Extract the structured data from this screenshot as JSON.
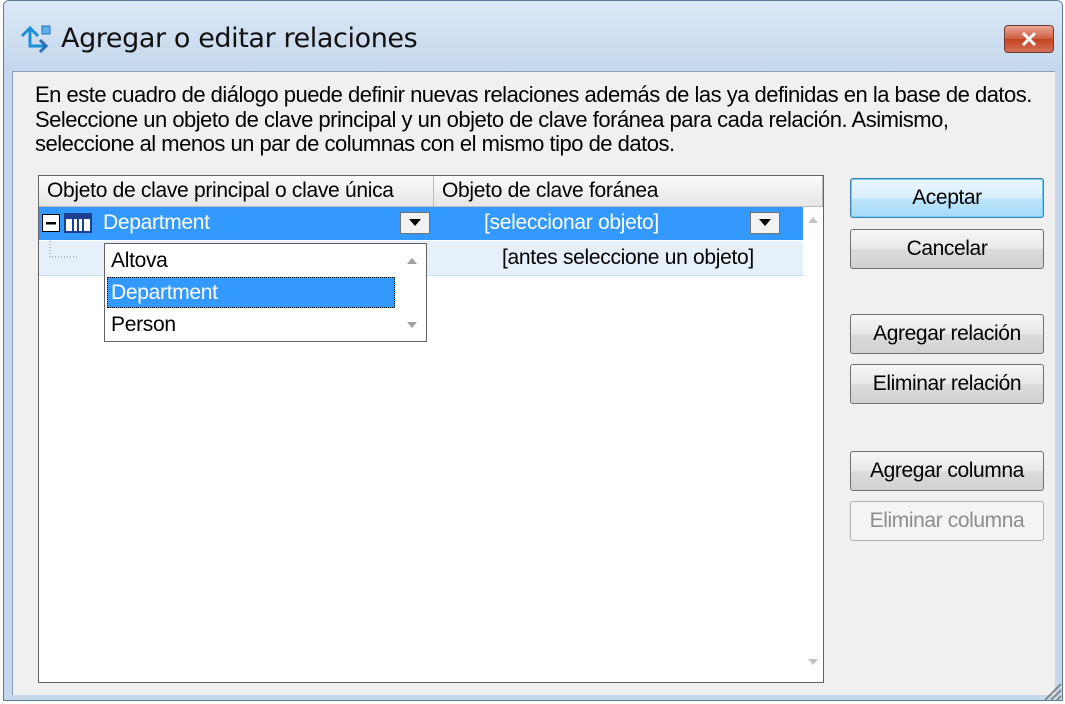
{
  "window": {
    "title": "Agregar o editar relaciones",
    "close_icon": "close-icon",
    "accent": "#3399ff",
    "close_color": "#c4421f"
  },
  "description": "En este cuadro de diálogo puede definir nuevas relaciones además de las ya definidas en la base de datos. Seleccione un objeto de clave principal y un objeto de clave foránea para cada relación. Asimismo, seleccione al menos un par de columnas con el mismo tipo de datos.",
  "grid": {
    "columns": [
      "Objeto de clave principal o clave única",
      "Objeto de clave foránea"
    ],
    "relation": {
      "primary_object": "Department",
      "foreign_object": "[seleccionar objeto]"
    },
    "column_row": {
      "foreign_column": "[antes seleccione un objeto]"
    }
  },
  "dropdown": {
    "options": [
      "Altova",
      "Department",
      "Person"
    ],
    "selected": "Department"
  },
  "buttons": {
    "ok": "Aceptar",
    "cancel": "Cancelar",
    "add_relation": "Agregar relación",
    "remove_relation": "Eliminar relación",
    "add_column": "Agregar columna",
    "remove_column": "Eliminar columna"
  }
}
